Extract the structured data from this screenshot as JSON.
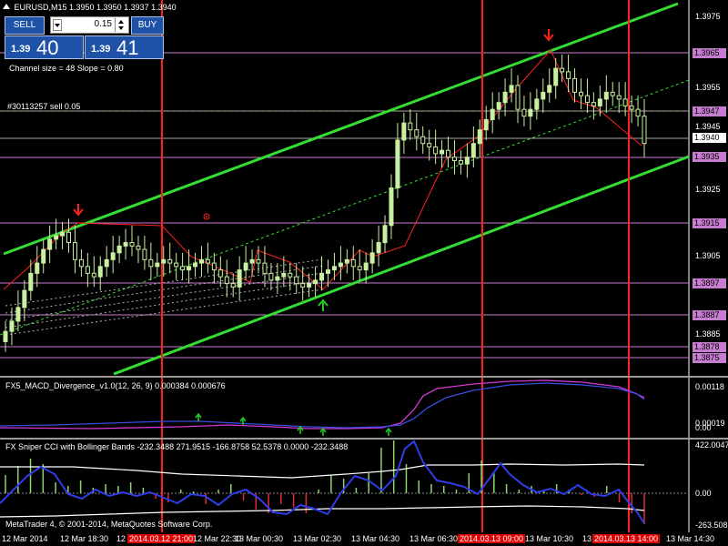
{
  "window": {
    "symbol_header": "EURUSD,M15  1.3950 1.3950 1.3937 1.3940"
  },
  "trade_panel": {
    "sell_label": "SELL",
    "buy_label": "BUY",
    "lot_value": "0.15",
    "sell_price_small": "1.39",
    "sell_price_big": "40",
    "buy_price_small": "1.39",
    "buy_price_big": "41"
  },
  "chart_info": {
    "channel_text": "Channel size = 48 Slope = 0.80",
    "order_text": "#30113257 sell 0.05"
  },
  "price_scale": {
    "ticks": [
      "1.3975",
      "1.3955",
      "1.3945",
      "1.3925",
      "1.3905",
      "1.3885"
    ],
    "labels": [
      {
        "value": "1.3965",
        "color": "#c77dcf"
      },
      {
        "value": "1.3947",
        "color": "#c77dcf"
      },
      {
        "value": "1.3940",
        "color": "#ffffff"
      },
      {
        "value": "1.3935",
        "color": "#c77dcf"
      },
      {
        "value": "1.3915",
        "color": "#c77dcf"
      },
      {
        "value": "1.3897",
        "color": "#c77dcf"
      },
      {
        "value": "1.3887",
        "color": "#c77dcf"
      },
      {
        "value": "1.3878",
        "color": "#c77dcf"
      },
      {
        "value": "1.3875",
        "color": "#c77dcf"
      }
    ]
  },
  "macd_pane": {
    "title": "FX5_MACD_Divergence_v1.0(12, 26, 9) 0.000384 0.000676",
    "scale_top": "0.00118",
    "scale_mid": "0.00019",
    "scale_bottom": "0.00"
  },
  "cci_pane": {
    "title": "FX Sniper CCI with Bollinger Bands  -232.3488 271.9515 -166.8758 52.5378 0.0000 -232.3488",
    "scale_top": "422.0047",
    "scale_mid": "0.00",
    "scale_bottom": "-263.508",
    "copyright": "MetaTrader 4, © 2001-2014, MetaQuotes Software Corp."
  },
  "time_axis": {
    "labels": [
      {
        "text": "12 Mar 2014",
        "highlight": false
      },
      {
        "text": "12 Mar 18:30",
        "highlight": false
      },
      {
        "text": "12 Mar 20:30",
        "highlight": false
      },
      {
        "text": "2014.03.12 21:00",
        "highlight": true
      },
      {
        "text": "12 Mar 22:30",
        "highlight": false
      },
      {
        "text": "13 Mar 00:30",
        "highlight": false
      },
      {
        "text": "13 Mar 02:30",
        "highlight": false
      },
      {
        "text": "13 Mar 04:30",
        "highlight": false
      },
      {
        "text": "13 Mar 06:30",
        "highlight": false
      },
      {
        "text": "2014.03.13 09:00",
        "highlight": true
      },
      {
        "text": "13 Mar 10:30",
        "highlight": false
      },
      {
        "text": "13 Mar 12:30",
        "highlight": false
      },
      {
        "text": "2014.03.13 14:00",
        "highlight": true
      },
      {
        "text": "13 Mar 14:30",
        "highlight": false
      }
    ]
  },
  "colors": {
    "channel": "#33dd33",
    "level_line": "#c77dcf",
    "vline": "#ff2020",
    "zigzag": "#ff2020",
    "candle_bull": "#c8f0a0",
    "candle_bear": "#000000",
    "candle_wick": "#c8f0a0",
    "macd_main": "#3a4ce0",
    "macd_signal": "#d23ad2",
    "cci_line": "#2e3de8",
    "cci_band": "#ffffff",
    "hist_pos": "#8fd46a",
    "hist_neg": "#e03030",
    "arrow_up": "#22cc22",
    "arrow_down": "#ff2020"
  },
  "chart_data": {
    "type": "candlestick",
    "symbol": "EURUSD",
    "timeframe": "M15",
    "ylim": [
      1.3872,
      1.3982
    ],
    "last_price": 1.394,
    "closes": [
      1.3885,
      1.3888,
      1.3892,
      1.3897,
      1.3902,
      1.3905,
      1.3909,
      1.3912,
      1.3913,
      1.3914,
      1.3911,
      1.3906,
      1.3904,
      1.3902,
      1.3901,
      1.3904,
      1.3906,
      1.3908,
      1.391,
      1.3911,
      1.391,
      1.3909,
      1.3906,
      1.3904,
      1.3905,
      1.3906,
      1.3905,
      1.3904,
      1.3903,
      1.3904,
      1.3905,
      1.3906,
      1.3905,
      1.3903,
      1.3901,
      1.3899,
      1.3898,
      1.3903,
      1.3905,
      1.3906,
      1.3905,
      1.3902,
      1.39,
      1.3901,
      1.3902,
      1.3901,
      1.3899,
      1.3898,
      1.3899,
      1.39,
      1.3902,
      1.3903,
      1.3904,
      1.3905,
      1.3906,
      1.3904,
      1.3903,
      1.3905,
      1.3908,
      1.3911,
      1.3916,
      1.3927,
      1.3941,
      1.3946,
      1.3944,
      1.3942,
      1.394,
      1.3939,
      1.3937,
      1.3938,
      1.3936,
      1.3935,
      1.3934,
      1.3936,
      1.394,
      1.3944,
      1.3947,
      1.395,
      1.3952,
      1.3955,
      1.3957,
      1.395,
      1.3948,
      1.395,
      1.3953,
      1.3955,
      1.3957,
      1.3962,
      1.3961,
      1.3959,
      1.3955,
      1.3954,
      1.3952,
      1.3951,
      1.3953,
      1.3955,
      1.3954,
      1.3953,
      1.3951,
      1.395,
      1.3948,
      1.394
    ]
  }
}
